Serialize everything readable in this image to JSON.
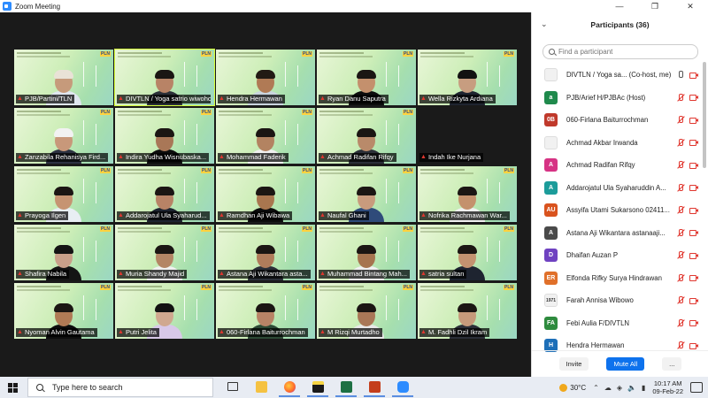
{
  "window": {
    "title": "Zoom Meeting"
  },
  "gallery": {
    "tiles": [
      {
        "name": "PJB/Partini/TLN",
        "skin": "#c69a7b",
        "hair": "#e9e2d6",
        "shirt": "#dfe6ef"
      },
      {
        "name": "DIVTLN / Yoga satrio wiwoho",
        "skin": "#b88366",
        "hair": "#1b1613",
        "shirt": "#2b2f38",
        "active": true
      },
      {
        "name": "Hendra Hermawan",
        "skin": "#b07a55",
        "hair": "#221a14",
        "shirt": "#c9d4de"
      },
      {
        "name": "Ryan Danu Saputra",
        "skin": "#c4906d",
        "hair": "#1b1613",
        "shirt": "#0d0d0d"
      },
      {
        "name": "Wella Rizkyta Ardiana",
        "skin": "#c79d80",
        "hair": "#121212",
        "shirt": "#1e2430"
      },
      {
        "name": "Zanzabila Rehanisya Fird...",
        "skin": "#c8987a",
        "hair": "#f2f2f2",
        "shirt": "#2d3242"
      },
      {
        "name": "Indira Yudha Wisnubaska...",
        "skin": "#a97757",
        "hair": "#1b1613",
        "shirt": "#0d0d0d"
      },
      {
        "name": "Mohammad Faderik",
        "skin": "#b38361",
        "hair": "#1b1613",
        "shirt": "#f0f0f0"
      },
      {
        "name": "Achmad Radifan Rifqy",
        "skin": "#b98a6a",
        "hair": "#1b1613",
        "shirt": "#2b2f38"
      },
      {
        "name": "Indah Ike Nurjana",
        "empty": true
      },
      {
        "name": "Prayoga Ilgen",
        "skin": "#c69472",
        "hair": "#1b1613",
        "shirt": "#e8eef3"
      },
      {
        "name": "Addarojatul Ula Syaharud...",
        "skin": "#b88366",
        "hair": "#1b1613",
        "shirt": "#1e2430"
      },
      {
        "name": "Ramdhan Aji Wibawa",
        "skin": "#a9764f",
        "hair": "#1b1613",
        "shirt": "#0d0d0d"
      },
      {
        "name": "Naufal Ghani",
        "skin": "#c89b7d",
        "hair": "#1b1613",
        "shirt": "#2f4b7a"
      },
      {
        "name": "Nofrika Rachmawan War...",
        "skin": "#c4916d",
        "hair": "#1b1613",
        "shirt": "#f1f1f1"
      },
      {
        "name": "Shafira Nabila",
        "skin": "#c9a08a",
        "hair": "#141414",
        "shirt": "#141414"
      },
      {
        "name": "Muria Shandy Majid",
        "skin": "#b48565",
        "hair": "#1b1613",
        "shirt": "#f0f0f0"
      },
      {
        "name": "Astana Aji Wikantara asta...",
        "skin": "#b07c5b",
        "hair": "#1b1613",
        "shirt": "#2b2f38"
      },
      {
        "name": "Muhammad Bintang Mah...",
        "skin": "#a6744f",
        "hair": "#1b1613",
        "shirt": "#f0f0f0"
      },
      {
        "name": "satria sultan",
        "skin": "#c39270",
        "hair": "#1b1613",
        "shirt": "#1e2430"
      },
      {
        "name": "Nyoman Alvin Gautama",
        "skin": "#b07a55",
        "hair": "#1b1613",
        "shirt": "#0d0d0d"
      },
      {
        "name": "Putri Jelita",
        "skin": "#d0a88f",
        "hair": "#121212",
        "shirt": "#d8c8e8"
      },
      {
        "name": "060-Firlana Baiturrochman",
        "skin": "#b88366",
        "hair": "#1b1613",
        "shirt": "#2d4a35"
      },
      {
        "name": "M Rizqi Murtadho",
        "skin": "#a97757",
        "hair": "#1b1613",
        "shirt": "#e8e8e8"
      },
      {
        "name": "M. Fadhli Dzil Ikram",
        "skin": "#c69a7b",
        "hair": "#1b1613",
        "shirt": "#2b2f38"
      }
    ],
    "tile_header_text": "In Class Training",
    "brand_badge": "PLN"
  },
  "participants": {
    "title": "Participants (36)",
    "search_placeholder": "Find a participant",
    "items": [
      {
        "name": "DIVTLN / Yoga sa...  (Co-host, me)",
        "avatar": "",
        "color": "#ffffff",
        "photo": true,
        "mic": "on"
      },
      {
        "name": "PJB/Arief H/PJBAc (Host)",
        "avatar": "a",
        "color": "#1f8a4c",
        "mic": "off"
      },
      {
        "name": "060-Firlana Baiturrochman",
        "avatar": "0B",
        "color": "#c0392b",
        "mic": "off"
      },
      {
        "name": "Achmad Akbar Irwanda",
        "avatar": "",
        "color": "#ffffff",
        "photo": true,
        "mic": "off"
      },
      {
        "name": "Achmad Radifan Rifqy",
        "avatar": "A",
        "color": "#d63384",
        "mic": "off"
      },
      {
        "name": "Addarojatul Ula Syaharuddin A...",
        "avatar": "A",
        "color": "#1c9c9a",
        "mic": "off"
      },
      {
        "name": "Assyifa Utami Sukarsono 02411...",
        "avatar": "AU",
        "color": "#d9531e",
        "mic": "off"
      },
      {
        "name": "Astana Aji Wikantara astanaaji...",
        "avatar": "A",
        "color": "#4a4a4a",
        "mic": "off"
      },
      {
        "name": "Dhaifan Auzan P",
        "avatar": "D",
        "color": "#6f42c1",
        "mic": "off"
      },
      {
        "name": "Elfonda Rifky Surya Hindrawan",
        "avatar": "ER",
        "color": "#e0702a",
        "mic": "off"
      },
      {
        "name": "Farah Annisa Wibowo",
        "avatar": "1971",
        "color": "#ffffff",
        "photo": true,
        "mic": "off"
      },
      {
        "name": "Febi Aulia F/DIVTLN",
        "avatar": "FA",
        "color": "#2e8b3e",
        "mic": "off"
      },
      {
        "name": "Hendra Hermawan",
        "avatar": "H",
        "color": "#1d6fb8",
        "mic": "off"
      }
    ],
    "invite_label": "Invite",
    "mute_all_label": "Mute All",
    "more_label": "..."
  },
  "taskbar": {
    "search_placeholder": "Type here to search",
    "temperature": "30°C",
    "time": "10:17 AM",
    "date": "09-Feb-22"
  }
}
